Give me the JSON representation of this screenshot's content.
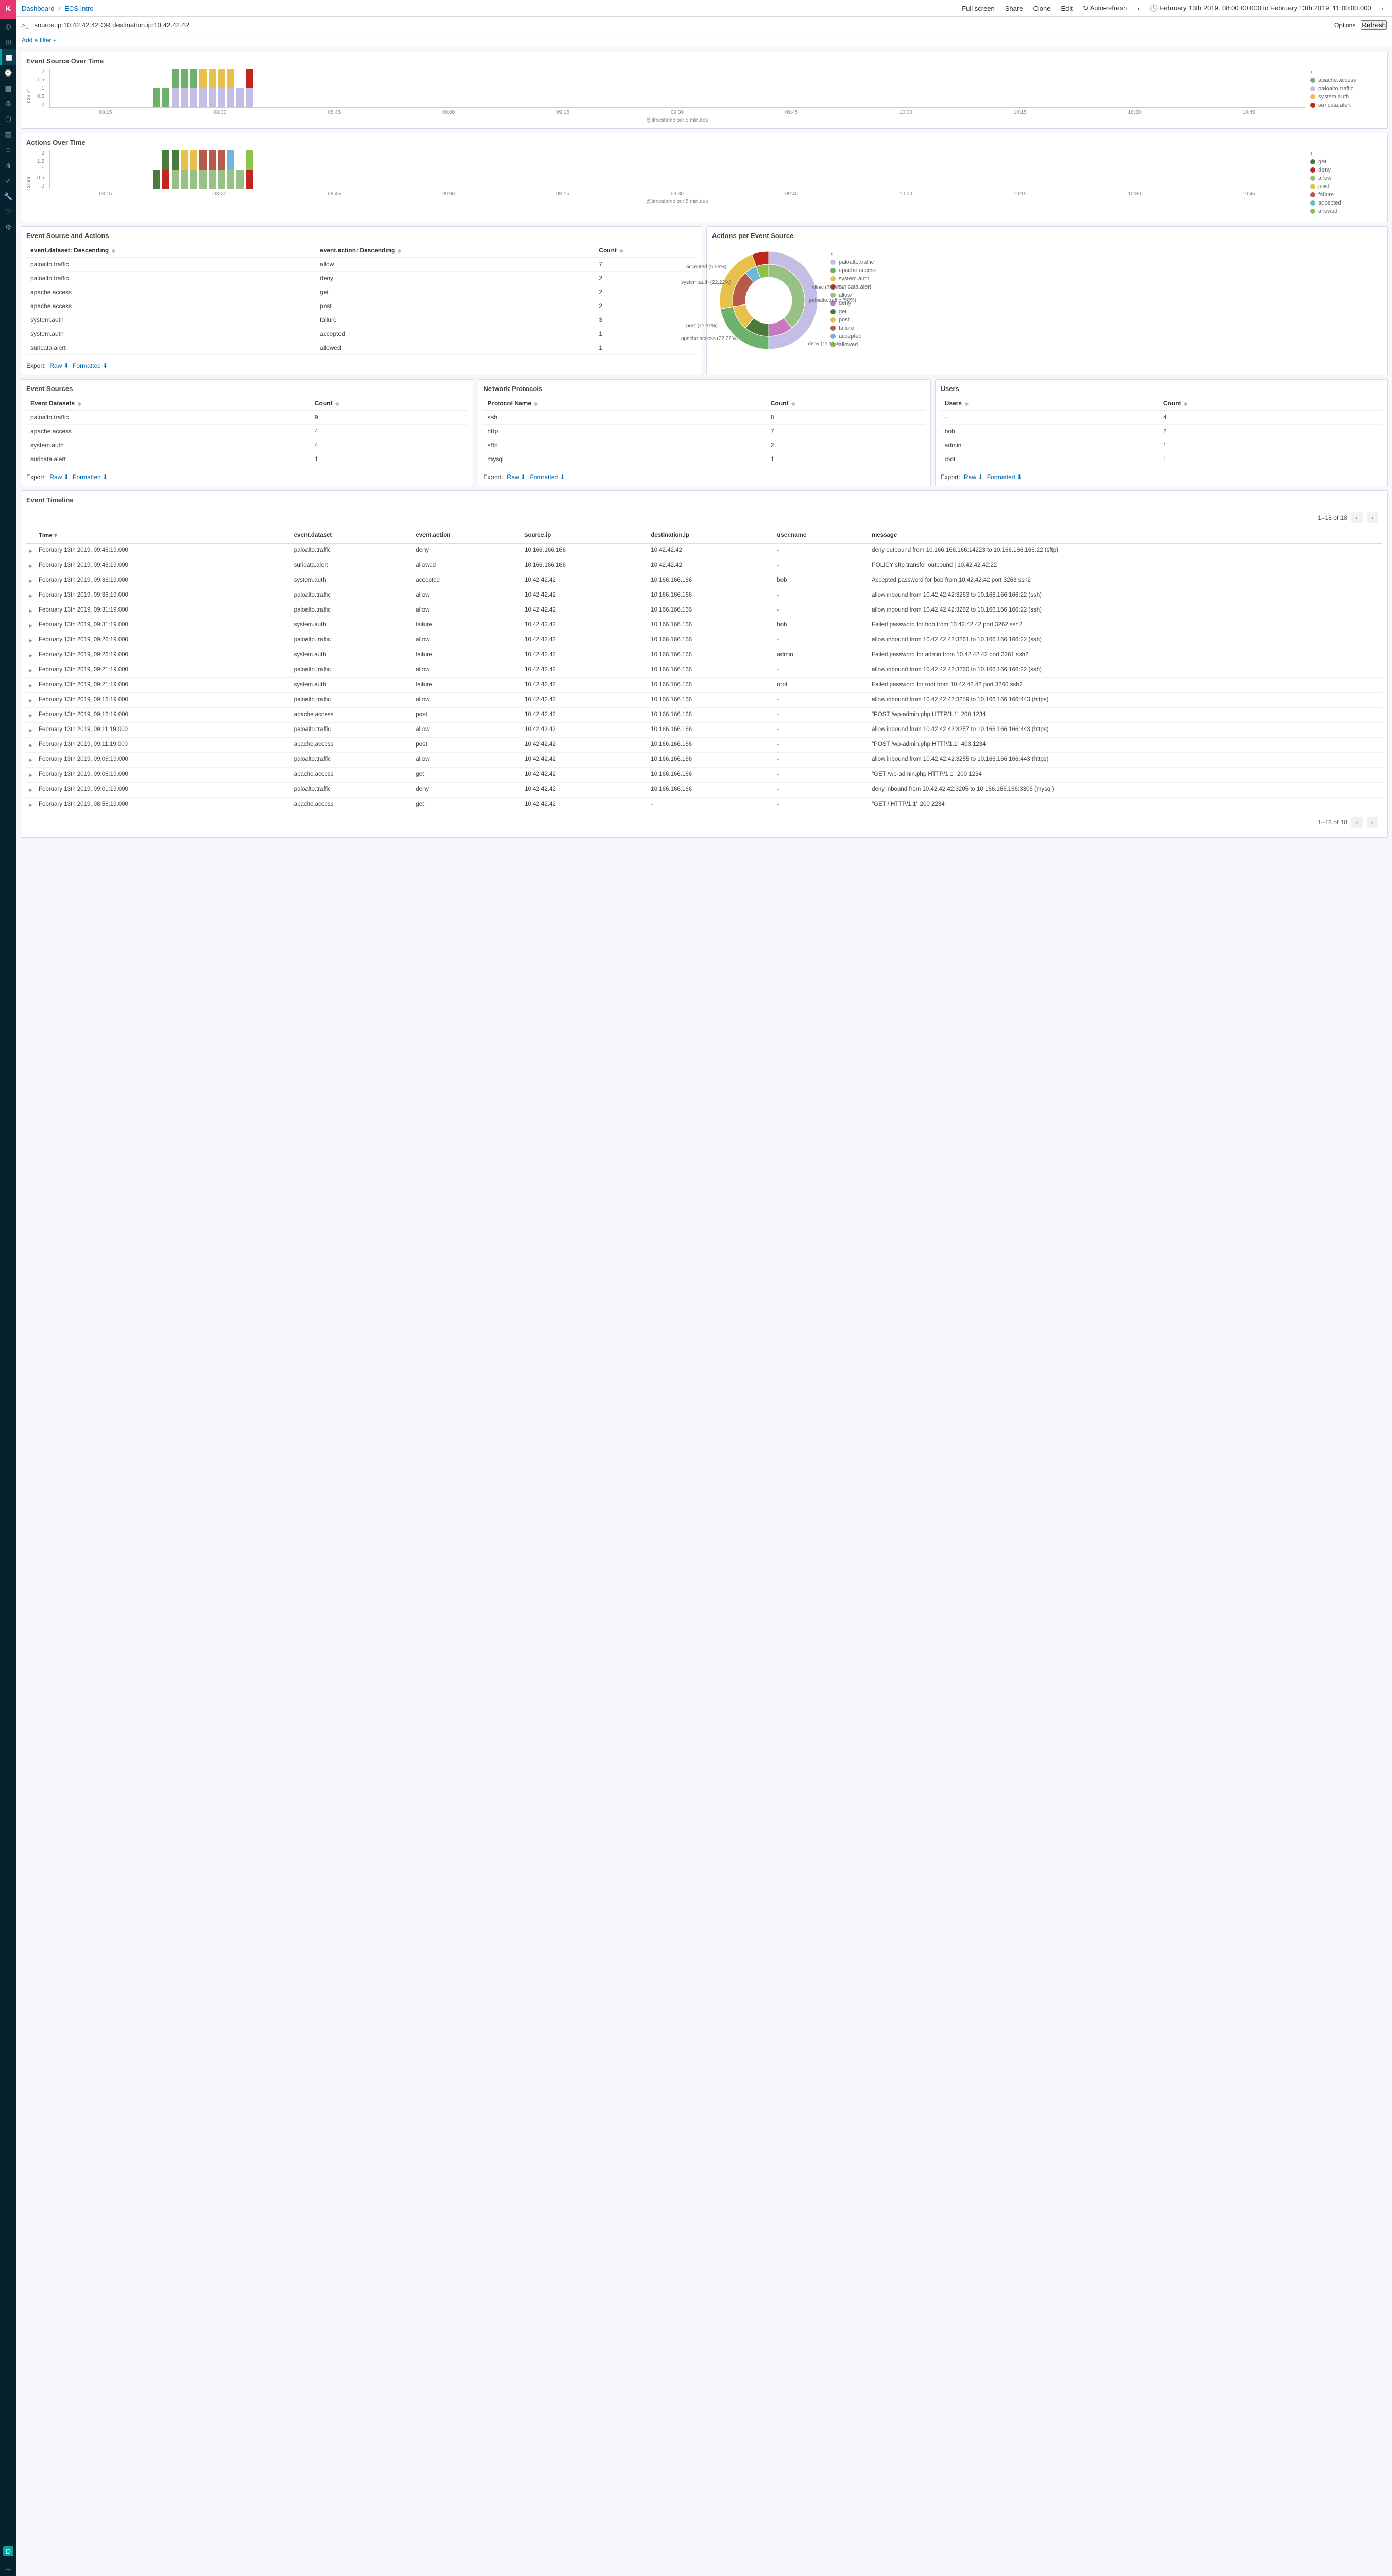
{
  "colors": {
    "apache": "#6db26c",
    "paloalto": "#c4bde6",
    "system": "#e8c14d",
    "suricata": "#bd271e",
    "get": "#4a7a3c",
    "deny": "#bd271e",
    "allow": "#97c284",
    "post": "#e8c14d",
    "failure": "#b55a4d",
    "accepted": "#6fb7d6",
    "allowed": "#8bc34a",
    "magenta": "#c678c0"
  },
  "breadcrumb": {
    "root": "Dashboard",
    "page": "ECS Intro"
  },
  "topbar": {
    "fullscreen": "Full screen",
    "share": "Share",
    "clone": "Clone",
    "edit": "Edit",
    "autorefresh": "Auto-refresh",
    "timerange": "February 13th 2019, 08:00:00.000 to February 13th 2019, 11:00:00.000",
    "options": "Options",
    "refresh": "Refresh"
  },
  "query": {
    "value": "source.ip:10.42.42.42 OR destination.ip:10.42.42.42"
  },
  "filter": {
    "add": "Add a filter +"
  },
  "chart1": {
    "title": "Event Source Over Time",
    "xcaption": "@timestamp per 5 minutes",
    "ylabel": "Count",
    "legend": [
      {
        "label": "apache.access",
        "colorKey": "apache"
      },
      {
        "label": "paloalto.traffic",
        "colorKey": "paloalto"
      },
      {
        "label": "system.auth",
        "colorKey": "system"
      },
      {
        "label": "suricata.alert",
        "colorKey": "suricata"
      }
    ]
  },
  "chart2": {
    "title": "Actions Over Time",
    "xcaption": "@timestamp per 5 minutes",
    "ylabel": "Count",
    "legend": [
      {
        "label": "get",
        "colorKey": "get"
      },
      {
        "label": "deny",
        "colorKey": "deny"
      },
      {
        "label": "allow",
        "colorKey": "allow"
      },
      {
        "label": "post",
        "colorKey": "post"
      },
      {
        "label": "failure",
        "colorKey": "failure"
      },
      {
        "label": "accepted",
        "colorKey": "accepted"
      },
      {
        "label": "allowed",
        "colorKey": "allowed"
      }
    ]
  },
  "chart_data": [
    {
      "id": "event_source_over_time",
      "type": "bar",
      "stacked": true,
      "xlabel": "@timestamp per 5 minutes",
      "ylabel": "Count",
      "ylim": [
        0,
        2
      ],
      "yticks": [
        0,
        0.5,
        1,
        1.5,
        2
      ],
      "categories": [
        "08:15",
        "08:30",
        "08:45",
        "09:00",
        "09:15",
        "09:30",
        "09:45",
        "10:00",
        "10:15",
        "10:30",
        "10:45"
      ],
      "bins": [
        {
          "t": "08:55",
          "stacks": [
            {
              "series": "apache.access",
              "v": 1
            }
          ]
        },
        {
          "t": "09:00",
          "stacks": [
            {
              "series": "apache.access",
              "v": 1
            }
          ]
        },
        {
          "t": "09:05",
          "stacks": [
            {
              "series": "paloalto.traffic",
              "v": 1
            },
            {
              "series": "apache.access",
              "v": 1
            }
          ]
        },
        {
          "t": "09:10",
          "stacks": [
            {
              "series": "paloalto.traffic",
              "v": 1
            },
            {
              "series": "apache.access",
              "v": 1
            }
          ]
        },
        {
          "t": "09:15",
          "stacks": [
            {
              "series": "paloalto.traffic",
              "v": 1
            },
            {
              "series": "apache.access",
              "v": 1
            }
          ]
        },
        {
          "t": "09:20",
          "stacks": [
            {
              "series": "paloalto.traffic",
              "v": 1
            },
            {
              "series": "system.auth",
              "v": 1
            }
          ]
        },
        {
          "t": "09:25",
          "stacks": [
            {
              "series": "paloalto.traffic",
              "v": 1
            },
            {
              "series": "system.auth",
              "v": 1
            }
          ]
        },
        {
          "t": "09:30",
          "stacks": [
            {
              "series": "paloalto.traffic",
              "v": 1
            },
            {
              "series": "system.auth",
              "v": 1
            }
          ]
        },
        {
          "t": "09:35",
          "stacks": [
            {
              "series": "paloalto.traffic",
              "v": 1
            },
            {
              "series": "system.auth",
              "v": 1
            }
          ]
        },
        {
          "t": "09:40",
          "stacks": [
            {
              "series": "paloalto.traffic",
              "v": 1
            }
          ]
        },
        {
          "t": "09:45",
          "stacks": [
            {
              "series": "paloalto.traffic",
              "v": 1
            },
            {
              "series": "suricata.alert",
              "v": 1
            }
          ]
        }
      ]
    },
    {
      "id": "actions_over_time",
      "type": "bar",
      "stacked": true,
      "xlabel": "@timestamp per 5 minutes",
      "ylabel": "Count",
      "ylim": [
        0,
        2
      ],
      "yticks": [
        0,
        0.5,
        1,
        1.5,
        2
      ],
      "categories": [
        "08:15",
        "08:30",
        "08:45",
        "09:00",
        "09:15",
        "09:30",
        "09:45",
        "10:00",
        "10:15",
        "10:30",
        "10:45"
      ],
      "bins": [
        {
          "t": "08:55",
          "stacks": [
            {
              "series": "get",
              "v": 1
            }
          ]
        },
        {
          "t": "09:00",
          "stacks": [
            {
              "series": "deny",
              "v": 1
            },
            {
              "series": "get",
              "v": 1
            }
          ]
        },
        {
          "t": "09:05",
          "stacks": [
            {
              "series": "allow",
              "v": 1
            },
            {
              "series": "get",
              "v": 1
            }
          ]
        },
        {
          "t": "09:10",
          "stacks": [
            {
              "series": "allow",
              "v": 1
            },
            {
              "series": "post",
              "v": 1
            }
          ]
        },
        {
          "t": "09:15",
          "stacks": [
            {
              "series": "allow",
              "v": 1
            },
            {
              "series": "post",
              "v": 1
            }
          ]
        },
        {
          "t": "09:20",
          "stacks": [
            {
              "series": "allow",
              "v": 1
            },
            {
              "series": "failure",
              "v": 1
            }
          ]
        },
        {
          "t": "09:25",
          "stacks": [
            {
              "series": "allow",
              "v": 1
            },
            {
              "series": "failure",
              "v": 1
            }
          ]
        },
        {
          "t": "09:30",
          "stacks": [
            {
              "series": "allow",
              "v": 1
            },
            {
              "series": "failure",
              "v": 1
            }
          ]
        },
        {
          "t": "09:35",
          "stacks": [
            {
              "series": "allow",
              "v": 1
            },
            {
              "series": "accepted",
              "v": 1
            }
          ]
        },
        {
          "t": "09:40",
          "stacks": [
            {
              "series": "allow",
              "v": 1
            }
          ]
        },
        {
          "t": "09:45",
          "stacks": [
            {
              "series": "deny",
              "v": 1
            },
            {
              "series": "allowed",
              "v": 1
            }
          ]
        }
      ]
    },
    {
      "id": "actions_per_event_source",
      "type": "pie",
      "variant": "donut_nested",
      "outer": [
        {
          "label": "paloalto.traffic",
          "value": 50.0,
          "colorKey": "paloalto"
        },
        {
          "label": "apache.access",
          "value": 22.22,
          "colorKey": "apache"
        },
        {
          "label": "system.auth",
          "value": 22.22,
          "colorKey": "system"
        },
        {
          "label": "suricata.alert",
          "value": 5.56,
          "colorKey": "suricata"
        }
      ],
      "inner": [
        {
          "label": "allow",
          "value": 38.89,
          "colorKey": "allow"
        },
        {
          "label": "deny",
          "value": 11.11,
          "colorKey": "magenta"
        },
        {
          "label": "get",
          "value": 11.11,
          "colorKey": "get"
        },
        {
          "label": "post",
          "value": 11.11,
          "colorKey": "post"
        },
        {
          "label": "failure",
          "value": 16.67,
          "colorKey": "failure"
        },
        {
          "label": "accepted",
          "value": 5.56,
          "colorKey": "accepted"
        },
        {
          "label": "allowed",
          "value": 5.56,
          "colorKey": "allowed"
        }
      ],
      "callouts": [
        "allow (38.89%)",
        "paloalto.traffic (50%)",
        "deny (11.11%)",
        "apache.access (22.22%)",
        "post (11.11%)",
        "system.auth (22.22%)",
        "accepted (5.56%)"
      ]
    }
  ],
  "panel_esa": {
    "title": "Event Source and Actions",
    "headers": [
      "event.dataset: Descending",
      "event.action: Descending",
      "Count"
    ],
    "rows": [
      [
        "paloalto.traffic",
        "allow",
        "7"
      ],
      [
        "paloalto.traffic",
        "deny",
        "2"
      ],
      [
        "apache.access",
        "get",
        "2"
      ],
      [
        "apache.access",
        "post",
        "2"
      ],
      [
        "system.auth",
        "failure",
        "3"
      ],
      [
        "system.auth",
        "accepted",
        "1"
      ],
      [
        "suricata.alert",
        "allowed",
        "1"
      ]
    ],
    "export": "Export:",
    "raw": "Raw",
    "fmt": "Formatted"
  },
  "panel_donut": {
    "title": "Actions per Event Source",
    "legend": [
      {
        "label": "paloalto.traffic",
        "colorKey": "paloalto"
      },
      {
        "label": "apache.access",
        "colorKey": "apache"
      },
      {
        "label": "system.auth",
        "colorKey": "system"
      },
      {
        "label": "suricata.alert",
        "colorKey": "suricata"
      },
      {
        "label": "allow",
        "colorKey": "allow"
      },
      {
        "label": "deny",
        "colorKey": "magenta"
      },
      {
        "label": "get",
        "colorKey": "get"
      },
      {
        "label": "post",
        "colorKey": "post"
      },
      {
        "label": "failure",
        "colorKey": "failure"
      },
      {
        "label": "accepted",
        "colorKey": "accepted"
      },
      {
        "label": "allowed",
        "colorKey": "allowed"
      }
    ],
    "labels": {
      "l_allow": "allow (38.89%)",
      "l_palo": "paloalto.traffic (50%)",
      "l_deny": "deny (11.11%)",
      "l_apache": "apache.access (22.22%)",
      "l_post": "post (11.11%)",
      "l_sys": "system.auth (22.22%)",
      "l_acc": "accepted (5.56%)"
    }
  },
  "panel_es": {
    "title": "Event Sources",
    "headers": [
      "Event Datasets",
      "Count"
    ],
    "rows": [
      [
        "paloalto.traffic",
        "9"
      ],
      [
        "apache.access",
        "4"
      ],
      [
        "system.auth",
        "4"
      ],
      [
        "suricata.alert",
        "1"
      ]
    ],
    "export": "Export:",
    "raw": "Raw",
    "fmt": "Formatted"
  },
  "panel_np": {
    "title": "Network Protocols",
    "headers": [
      "Protocol Name",
      "Count"
    ],
    "rows": [
      [
        "ssh",
        "8"
      ],
      [
        "http",
        "7"
      ],
      [
        "sftp",
        "2"
      ],
      [
        "mysql",
        "1"
      ]
    ],
    "export": "Export:",
    "raw": "Raw",
    "fmt": "Formatted"
  },
  "panel_us": {
    "title": "Users",
    "headers": [
      "Users",
      "Count"
    ],
    "rows": [
      [
        "-",
        "4"
      ],
      [
        "bob",
        "2"
      ],
      [
        "admin",
        "1"
      ],
      [
        "root",
        "1"
      ]
    ],
    "export": "Export:",
    "raw": "Raw",
    "fmt": "Formatted"
  },
  "timeline": {
    "title": "Event Timeline",
    "pager": "1–18 of 18",
    "headers": [
      "Time",
      "event.dataset",
      "event.action",
      "source.ip",
      "destination.ip",
      "user.name",
      "message"
    ],
    "rows": [
      [
        "February 13th 2019, 09:46:19.000",
        "paloalto.traffic",
        "deny",
        "10.166.166.166",
        "10.42.42.42",
        "-",
        "deny outbound from 10.166.166.166:14223 to 10.166.166.166:22 (sftp)"
      ],
      [
        "February 13th 2019, 09:46:19.000",
        "suricata.alert",
        "allowed",
        "10.166.166.166",
        "10.42.42.42",
        "-",
        "POLICY sftp transfer outbound | 10.42.42.42:22"
      ],
      [
        "February 13th 2019, 09:36:19.000",
        "system.auth",
        "accepted",
        "10.42.42.42",
        "10.166.166.166",
        "bob",
        "Accepted password for bob from 10.42.42.42 port 3263 ssh2"
      ],
      [
        "February 13th 2019, 09:36:19.000",
        "paloalto.traffic",
        "allow",
        "10.42.42.42",
        "10.166.166.166",
        "-",
        "allow inbound from 10.42.42.42:3263 to 10.166.166.166:22 (ssh)"
      ],
      [
        "February 13th 2019, 09:31:19.000",
        "paloalto.traffic",
        "allow",
        "10.42.42.42",
        "10.166.166.166",
        "-",
        "allow inbound from 10.42.42.42:3262 to 10.166.166.166:22 (ssh)"
      ],
      [
        "February 13th 2019, 09:31:19.000",
        "system.auth",
        "failure",
        "10.42.42.42",
        "10.166.166.166",
        "bob",
        "Failed password for bob from 10.42.42.42 port 3262 ssh2"
      ],
      [
        "February 13th 2019, 09:26:19.000",
        "paloalto.traffic",
        "allow",
        "10.42.42.42",
        "10.166.166.166",
        "-",
        "allow inbound from 10.42.42.42:3261 to 10.166.166.166:22 (ssh)"
      ],
      [
        "February 13th 2019, 09:26:19.000",
        "system.auth",
        "failure",
        "10.42.42.42",
        "10.166.166.166",
        "admin",
        "Failed password for admin from 10.42.42.42 port 3261 ssh2"
      ],
      [
        "February 13th 2019, 09:21:19.000",
        "paloalto.traffic",
        "allow",
        "10.42.42.42",
        "10.166.166.166",
        "-",
        "allow inbound from 10.42.42.42:3260 to 10.166.166.166:22 (ssh)"
      ],
      [
        "February 13th 2019, 09:21:19.000",
        "system.auth",
        "failure",
        "10.42.42.42",
        "10.166.166.166",
        "root",
        "Failed password for root from 10.42.42.42 port 3260 ssh2"
      ],
      [
        "February 13th 2019, 09:16:19.000",
        "paloalto.traffic",
        "allow",
        "10.42.42.42",
        "10.166.166.166",
        "-",
        "allow inbound from 10.42.42.42:3259 to 10.166.166.166:443 (https)"
      ],
      [
        "February 13th 2019, 09:16:19.000",
        "apache.access",
        "post",
        "10.42.42.42",
        "10.166.166.166",
        "-",
        "\"POST /wp-admin.php HTTP/1.1\" 200 1234"
      ],
      [
        "February 13th 2019, 09:11:19.000",
        "paloalto.traffic",
        "allow",
        "10.42.42.42",
        "10.166.166.166",
        "-",
        "allow inbound from 10.42.42.42:3257 to 10.166.166.166:443 (https)"
      ],
      [
        "February 13th 2019, 09:11:19.000",
        "apache.access",
        "post",
        "10.42.42.42",
        "10.166.166.166",
        "-",
        "\"POST /wp-admin.php HTTP/1.1\" 403 1234"
      ],
      [
        "February 13th 2019, 09:06:19.000",
        "paloalto.traffic",
        "allow",
        "10.42.42.42",
        "10.166.166.166",
        "-",
        "allow inbound from 10.42.42.42:3255 to 10.166.166.166:443 (https)"
      ],
      [
        "February 13th 2019, 09:06:19.000",
        "apache.access",
        "get",
        "10.42.42.42",
        "10.166.166.166",
        "-",
        "\"GET /wp-admin.php HTTP/1.1\" 200 1234"
      ],
      [
        "February 13th 2019, 09:01:19.000",
        "paloalto.traffic",
        "deny",
        "10.42.42.42",
        "10.166.166.166",
        "-",
        "deny inbound from 10.42.42.42:3205 to 10.166.166.166:3306 (mysql)"
      ],
      [
        "February 13th 2019, 08:56:19.000",
        "apache.access",
        "get",
        "10.42.42.42",
        "-",
        "-",
        "\"GET / HTTP/1.1\" 200 2234"
      ]
    ]
  }
}
